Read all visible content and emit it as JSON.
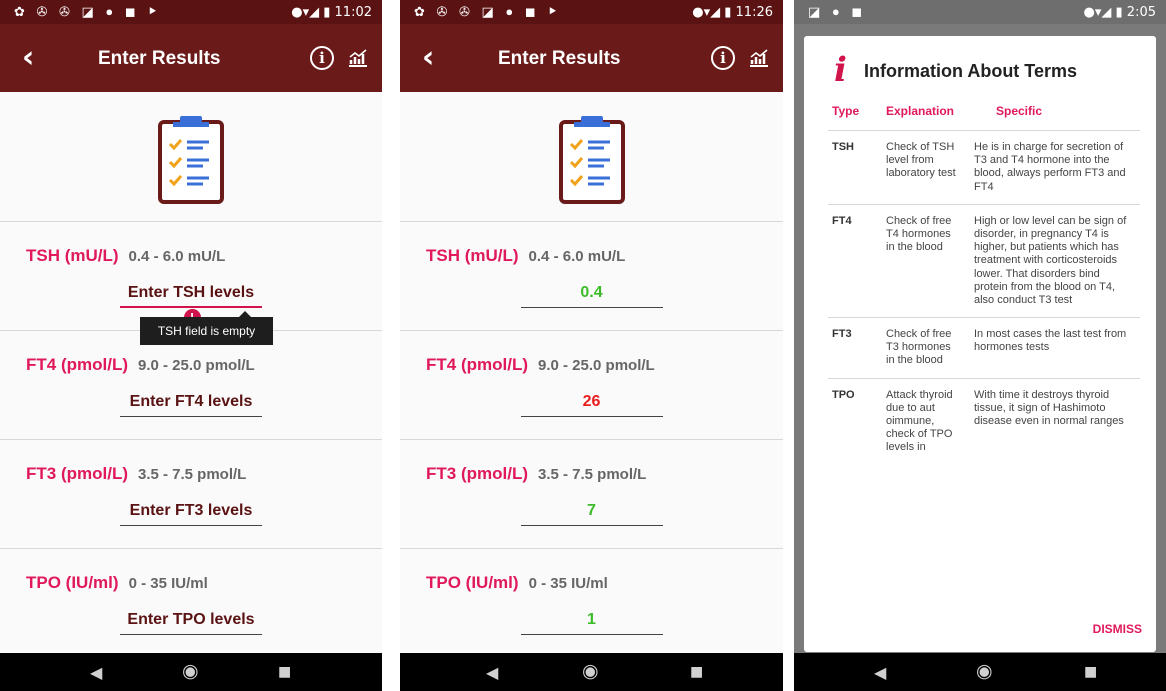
{
  "status_p1": {
    "icons": "✿ ✇ ✇ ◪ ● ◼ ⯈",
    "time": "11:02"
  },
  "status_p2": {
    "icons": "✿ ✇ ✇ ◪ ● ◼ ⯈",
    "time": "11:26"
  },
  "status_p3": {
    "icons": "◪ ● ◼",
    "time": "2:05"
  },
  "signal": "●▾◢ ▮",
  "appbar": {
    "back": "‹",
    "title": "Enter Results",
    "info": "i"
  },
  "screen1": {
    "tooltip": "TSH field is empty",
    "error_mark": "!",
    "rows": [
      {
        "label": "TSH (mU/L)",
        "range": "0.4 - 6.0 mU/L",
        "input": "Enter TSH levels"
      },
      {
        "label": "FT4 (pmol/L)",
        "range": "9.0 - 25.0 pmol/L",
        "input": "Enter FT4 levels"
      },
      {
        "label": "FT3 (pmol/L)",
        "range": "3.5 - 7.5 pmol/L",
        "input": "Enter FT3 levels"
      },
      {
        "label": "TPO (IU/ml)",
        "range": "0 - 35 IU/ml",
        "input": "Enter TPO levels"
      }
    ]
  },
  "screen2": {
    "rows": [
      {
        "label": "TSH (mU/L)",
        "range": "0.4 - 6.0 mU/L",
        "value": "0.4",
        "status_color": "#3dbb2b"
      },
      {
        "label": "FT4 (pmol/L)",
        "range": "9.0 - 25.0 pmol/L",
        "value": "26",
        "status_color": "#ec1d1d"
      },
      {
        "label": "FT3 (pmol/L)",
        "range": "3.5 - 7.5 pmol/L",
        "value": "7",
        "status_color": "#3dbb2b"
      },
      {
        "label": "TPO (IU/ml)",
        "range": "0 - 35 IU/ml",
        "value": "1",
        "status_color": "#3dbb2b"
      }
    ]
  },
  "dialog": {
    "icon": "i",
    "title": "Information About Terms",
    "headers": {
      "type": "Type",
      "explanation": "Explanation",
      "specific": "Specific"
    },
    "rows": [
      {
        "type": "TSH",
        "explanation": "Check of TSH level from laboratory test",
        "specific": "He is in charge for secretion of T3 and T4 hormone into the blood, always perform FT3 and FT4"
      },
      {
        "type": "FT4",
        "explanation": "Check of free T4 hormones in the blood",
        "specific": "High or low level can be sign of disorder, in pregnancy T4 is higher, but patients which has treatment with corticosteroids lower. That disorders bind protein from the blood on T4, also conduct T3 test"
      },
      {
        "type": "FT3",
        "explanation": "Check of free T3 hormones in the blood",
        "specific": "In most cases the last test from hormones tests"
      },
      {
        "type": "TPO",
        "explanation": "Attack thyroid due to aut oimmune, check of TPO levels in",
        "specific": "With time it destroys thyroid tissue, it sign of Hashimoto disease even in normal ranges"
      }
    ],
    "dismiss": "DISMISS"
  },
  "nav": {
    "back": "◀",
    "home": "◉",
    "recents": "■"
  },
  "colors": {
    "appbar": "#6b1a1a",
    "accent": "#e0195a",
    "ok": "#3dbb2b",
    "high": "#ec1d1d"
  }
}
